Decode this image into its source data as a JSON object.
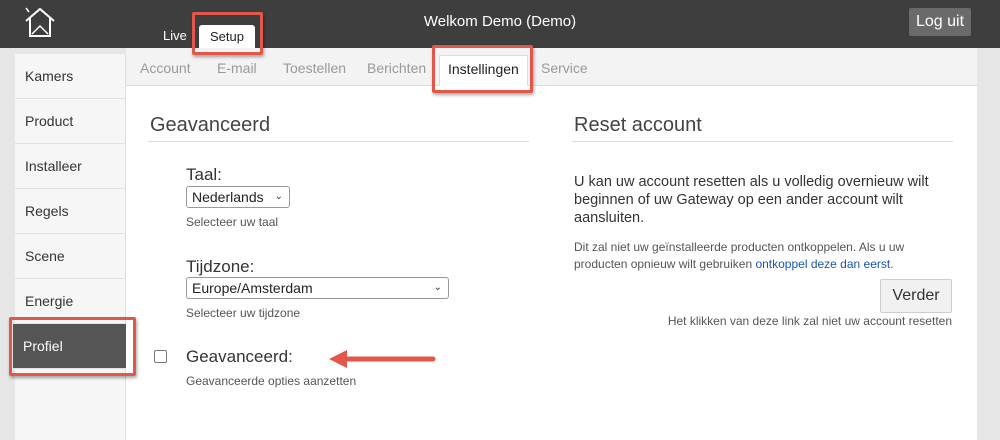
{
  "header": {
    "title": "Welkom Demo (Demo)",
    "logout_label": "Log uit",
    "tabs": [
      {
        "label": "Live"
      },
      {
        "label": "Setup"
      }
    ],
    "logo_icon": "house-icon"
  },
  "sidebar": {
    "items": [
      {
        "label": "Kamers"
      },
      {
        "label": "Product"
      },
      {
        "label": "Installeer"
      },
      {
        "label": "Regels"
      },
      {
        "label": "Scene"
      },
      {
        "label": "Energie"
      },
      {
        "label": "Profiel",
        "active": true
      }
    ]
  },
  "subtabs": [
    {
      "label": "Account"
    },
    {
      "label": "E-mail"
    },
    {
      "label": "Toestellen"
    },
    {
      "label": "Berichten"
    },
    {
      "label": "Instellingen",
      "active": true
    },
    {
      "label": "Service"
    }
  ],
  "advanced": {
    "title": "Geavanceerd",
    "language": {
      "label": "Taal:",
      "value": "Nederlands",
      "help": "Selecteer uw taal"
    },
    "timezone": {
      "label": "Tijdzone:",
      "value": "Europe/Amsterdam",
      "help": "Selecteer uw tijdzone"
    },
    "toggle": {
      "label": "Geavanceerd:",
      "help": "Geavanceerde opties aanzetten",
      "checked": false
    }
  },
  "reset": {
    "title": "Reset account",
    "text": "U kan uw account resetten als u volledig overnieuw wilt beginnen of uw Gateway op een ander account wilt aansluiten.",
    "note_prefix": "Dit zal niet uw geïnstalleerde producten ontkoppelen. Als u uw producten opnieuw wilt gebruiken ",
    "note_link": "ontkoppel deze dan eerst",
    "note_suffix": ".",
    "button_label": "Verder",
    "button_help": "Het klikken van deze link zal niet uw account resetten"
  },
  "colors": {
    "topbar": "#3e3e3e",
    "highlight": "#e3564a",
    "link": "#1a56a8"
  }
}
